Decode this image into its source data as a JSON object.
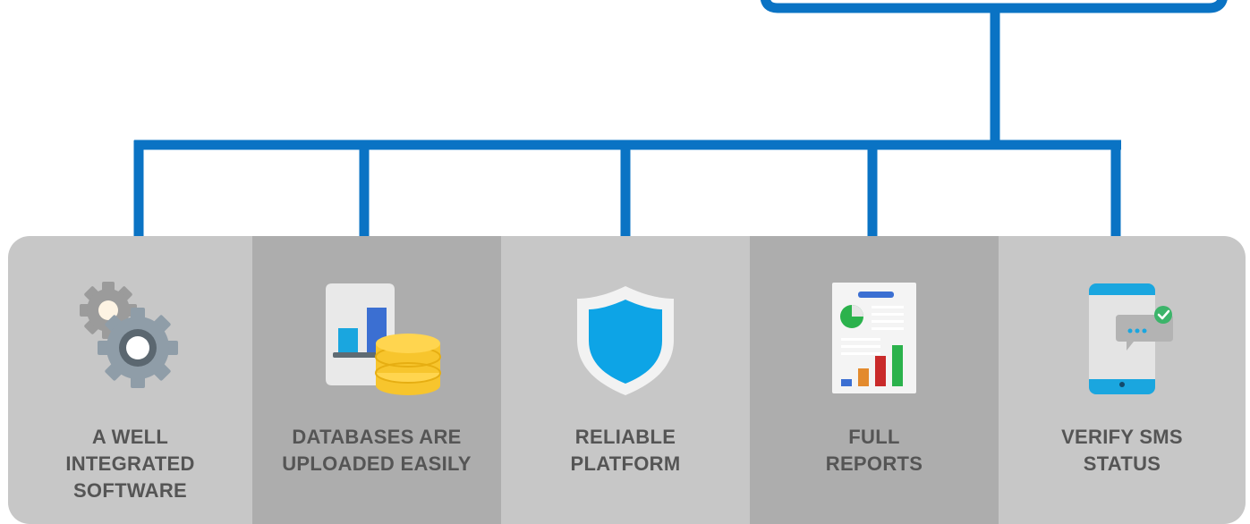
{
  "colors": {
    "connector": "#0a73c4",
    "panel_light": "#c7c7c7",
    "panel_dark": "#adadad",
    "label_text": "#555555"
  },
  "features": [
    {
      "icon": "gears-icon",
      "lines": [
        "A WELL",
        "INTEGRATED",
        "SOFTWARE"
      ]
    },
    {
      "icon": "database-upload-icon",
      "lines": [
        "DATABASES ARE",
        "UPLOADED EASILY"
      ]
    },
    {
      "icon": "shield-icon",
      "lines": [
        "RELIABLE",
        "PLATFORM"
      ]
    },
    {
      "icon": "report-icon",
      "lines": [
        "FULL",
        "REPORTS"
      ]
    },
    {
      "icon": "sms-verify-icon",
      "lines": [
        "VERIFY SMS",
        "STATUS"
      ]
    }
  ]
}
